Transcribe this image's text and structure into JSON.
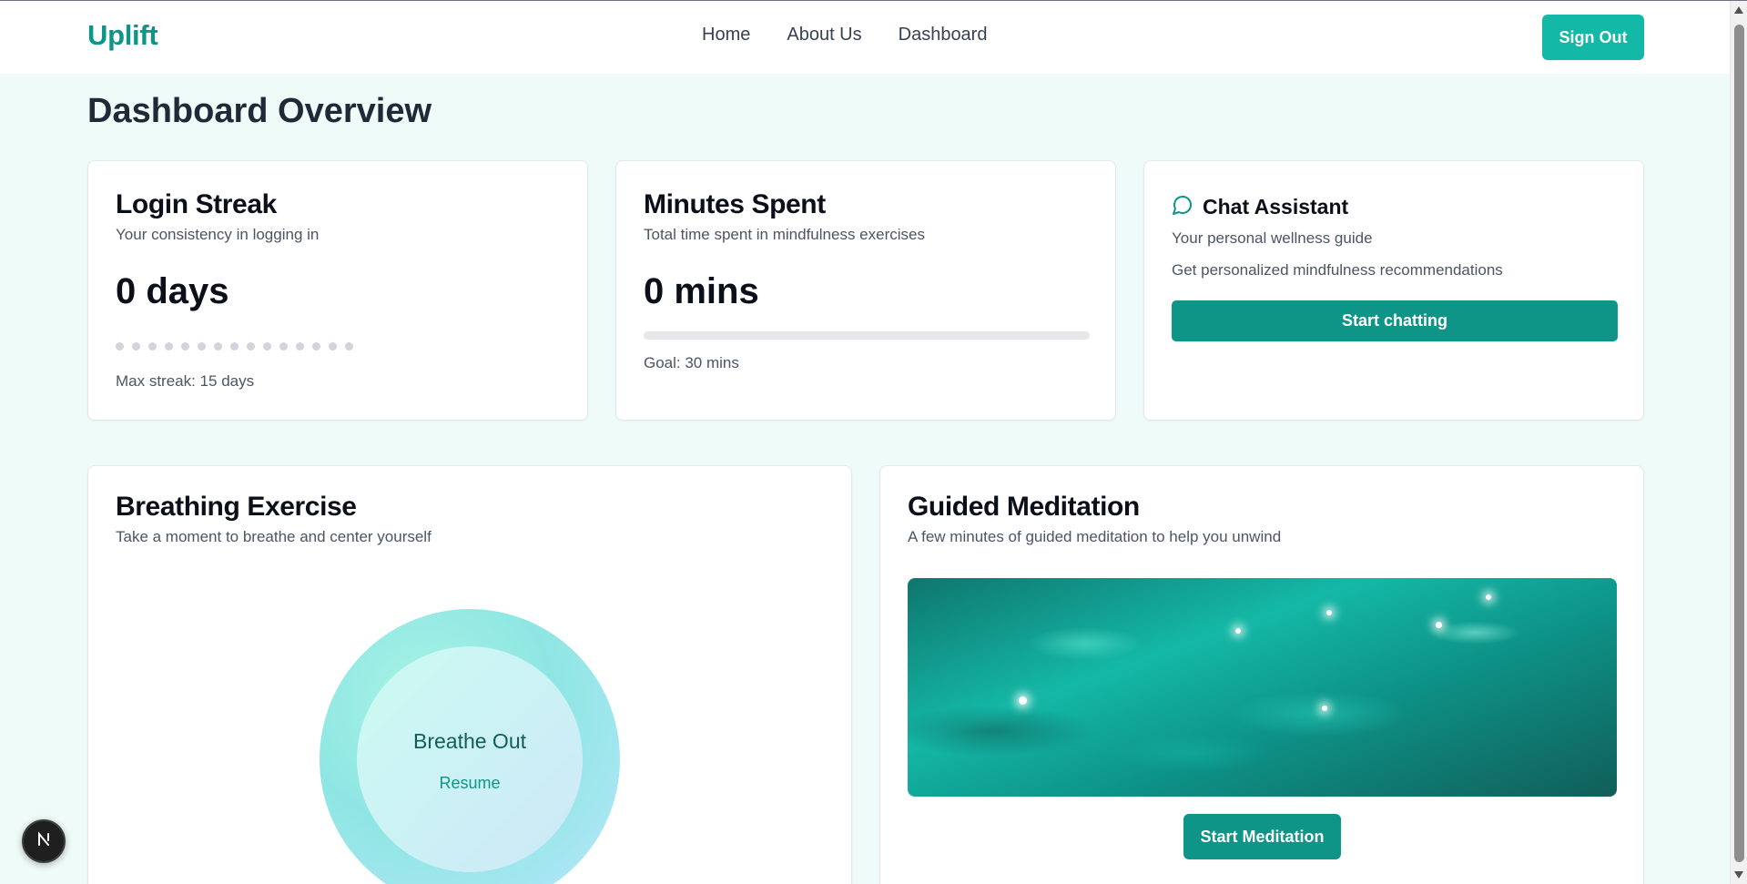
{
  "header": {
    "brand": "Uplift",
    "nav": [
      "Home",
      "About Us",
      "Dashboard"
    ],
    "sign_out_label": "Sign Out"
  },
  "page": {
    "title": "Dashboard Overview"
  },
  "login_streak": {
    "title": "Login Streak",
    "subtitle": "Your consistency in logging in",
    "value": "0 days",
    "dot_count": 15,
    "active_dots": 0,
    "max_streak_text": "Max streak: 15 days"
  },
  "minutes_spent": {
    "title": "Minutes Spent",
    "subtitle": "Total time spent in mindfulness exercises",
    "value": "0 mins",
    "progress_fraction": 0,
    "goal_text": "Goal: 30 mins"
  },
  "chat_assistant": {
    "icon": "chat-bubble-icon",
    "title": "Chat Assistant",
    "subtitle": "Your personal wellness guide",
    "description": "Get personalized mindfulness recommendations",
    "button_label": "Start chatting"
  },
  "breathing": {
    "title": "Breathing Exercise",
    "subtitle": "Take a moment to breathe and center yourself",
    "phase": "Breathe Out",
    "action_label": "Resume"
  },
  "meditation": {
    "title": "Guided Meditation",
    "subtitle": "A few minutes of guided meditation to help you unwind",
    "button_label": "Start Meditation"
  },
  "colors": {
    "accent": "#14b8a6",
    "accent_dark": "#0f9488",
    "background": "#effbf8"
  }
}
